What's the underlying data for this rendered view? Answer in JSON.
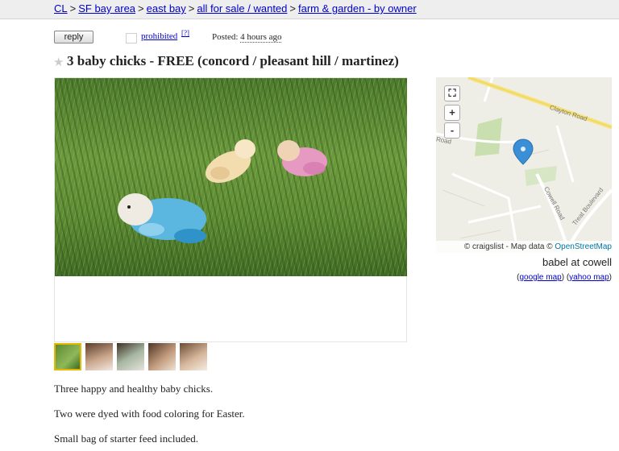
{
  "breadcrumb": {
    "items": [
      "CL",
      "SF bay area",
      "east bay",
      "all for sale / wanted",
      "farm & garden - by owner"
    ],
    "separator": ">"
  },
  "actions": {
    "reply_label": "reply",
    "prohibited_label": "prohibited",
    "prohibited_help": "[?]",
    "posted_label": "Posted:",
    "posted_time": "4 hours ago"
  },
  "posting": {
    "star_icon": "star-icon",
    "title": "3 baby chicks - FREE (concord / pleasant hill / martinez)"
  },
  "gallery": {
    "thumbnail_count": 5,
    "selected_index": 0
  },
  "map": {
    "attribution_prefix": "© craigslist - Map data ©",
    "attribution_link": "OpenStreetMap",
    "road_labels": [
      "Clayton Road",
      "Cowell Road",
      "Treat Boulevard",
      "Road"
    ],
    "zoom_in": "+",
    "zoom_out": "-",
    "location_name": "babel at cowell",
    "links": {
      "open": "(",
      "google": "google map",
      "middle": ") (",
      "yahoo": "yahoo map",
      "close": ")"
    },
    "marker_color": "#3a8fd6"
  },
  "body": {
    "lines": [
      "Three happy and healthy baby chicks.",
      "Two were dyed with food coloring for Easter.",
      "Small bag of starter feed included."
    ]
  },
  "colors": {
    "link": "#0000cc",
    "topbar": "#eeeeee",
    "selected_thumb_border": "#e6b800"
  }
}
